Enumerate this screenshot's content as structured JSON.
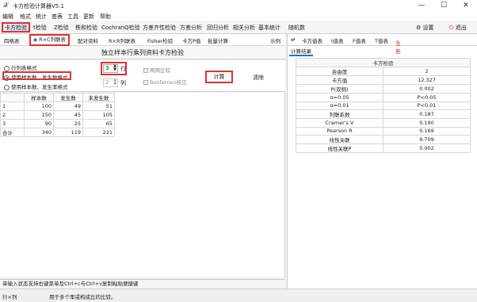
{
  "app": {
    "title": "卡方检验计算器V5.1"
  },
  "window_controls": {
    "minimize": "—",
    "maximize": "☐",
    "close": "✕"
  },
  "menu": [
    "编辑",
    "格式",
    "统计",
    "查表",
    "工具",
    "更新",
    "帮助"
  ],
  "tabs": [
    "卡方检验",
    "t检验",
    "Z检验",
    "秩和检验",
    "CochranQ检验",
    "方差齐性检验",
    "方差分析",
    "回归分析",
    "相关分析",
    "基本统计",
    "随机数"
  ],
  "active_tab": "卡方检验",
  "top_right": {
    "settings": "设置",
    "exit": "退出"
  },
  "subtabs": [
    "四格表",
    "R×C列联表",
    "配对资料",
    "R×R列联表",
    "Fisher检验",
    "卡方P值",
    "批量计算"
  ],
  "active_subtab": "R×C列联表",
  "example_label": "示例",
  "panel_title": "独立样本行乘列资料卡方检验",
  "input_formats": {
    "options": [
      "行列表格式",
      "使用样本数、发生数格式",
      "使用样本数、发生率格式"
    ],
    "selected_index": 1
  },
  "rows_spinner": {
    "value": "3",
    "label": "行"
  },
  "cols_spinner": {
    "value": "2",
    "label": "列"
  },
  "checkboxes": {
    "pairwise": "两两比较",
    "bonferroni": "Bonferroni校正"
  },
  "buttons": {
    "calculate": "计算",
    "clear": "清除"
  },
  "data_grid": {
    "headers": [
      "",
      "样本数",
      "发生数",
      "未发生数"
    ],
    "rows": [
      [
        "1",
        "100",
        "49",
        "51"
      ],
      [
        "2",
        "150",
        "45",
        "105"
      ],
      [
        "3",
        "90",
        "25",
        "65"
      ],
      [
        "合计",
        "340",
        "119",
        "221"
      ]
    ]
  },
  "hint": "单输入状态支持右键菜单及Ctrl+c与Ctrl+v复制粘贴便捷键",
  "status_bar": {
    "left": "行×列",
    "message": "用于多个率或构成比的比较。"
  },
  "right_tabs": [
    "卡方值表",
    "t值表",
    "F值表",
    "T值表",
    "注册"
  ],
  "result_tab": "计算结果",
  "results": {
    "title": "卡方检验",
    "rows": [
      [
        "自由度",
        "2"
      ],
      [
        "卡方值",
        "12.327"
      ],
      [
        "P(双侧)",
        "0.002"
      ],
      [
        "α=0.05",
        "P<0.05"
      ],
      [
        "α=0.01",
        "P<0.01"
      ],
      [
        "列联系数",
        "0.187"
      ],
      [
        "Cramer's V",
        "0.190"
      ],
      [
        "Pearson R",
        "0.169"
      ],
      [
        "线性关联",
        "9.709"
      ],
      [
        "线性关联P",
        "0.002"
      ]
    ]
  },
  "colors": {
    "highlight_red": "#e03131",
    "accent_blue": "#1e6fd9"
  }
}
